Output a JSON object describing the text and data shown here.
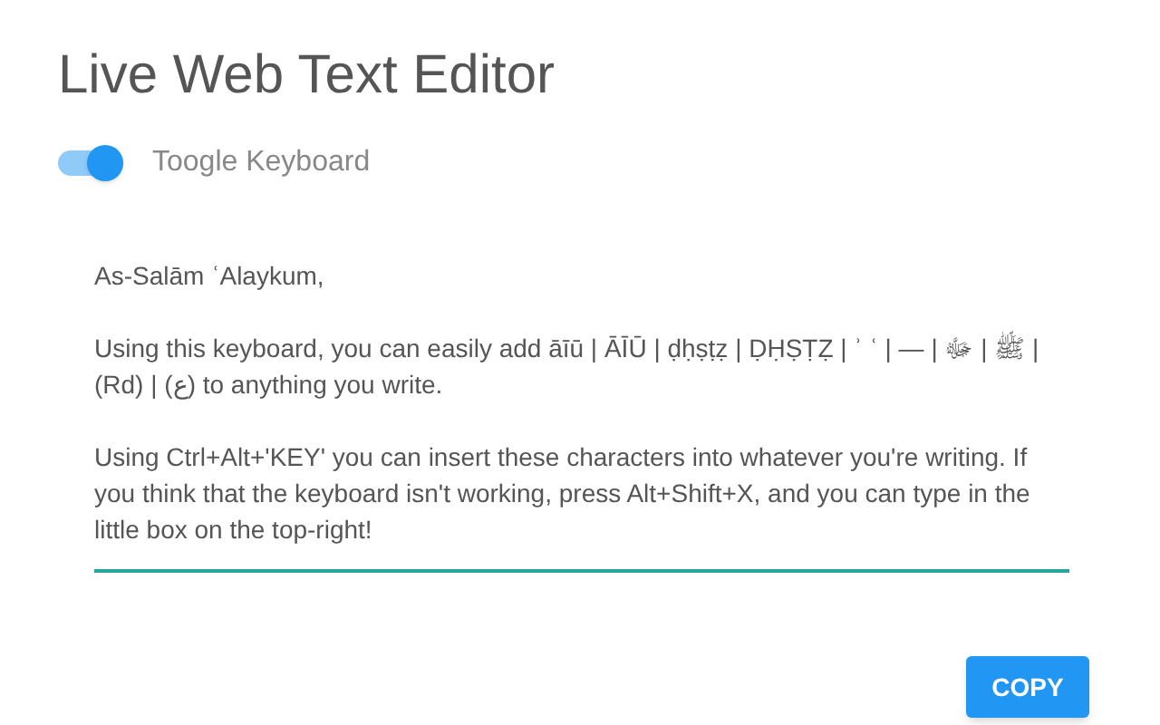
{
  "title": "Live Web Text Editor",
  "toggle": {
    "label": "Toogle Keyboard",
    "on": true
  },
  "editor": {
    "paragraphs": [
      "As-Salām ʿAlaykum,",
      "Using this keyboard, you can easily add āīū | ĀĪŪ | ḍḥṣṭẓ | ḌḤṢṬẒ | ʾ ʿ | — | ﷺ | ﷻ | (Rd) | (ع) to anything you write.",
      "Using Ctrl+Alt+'KEY' you can insert these characters into whatever you're writing. If you think that the keyboard isn't working, press Alt+Shift+X, and you can type in the little box on the top-right!"
    ]
  },
  "copy_button": "COPY"
}
